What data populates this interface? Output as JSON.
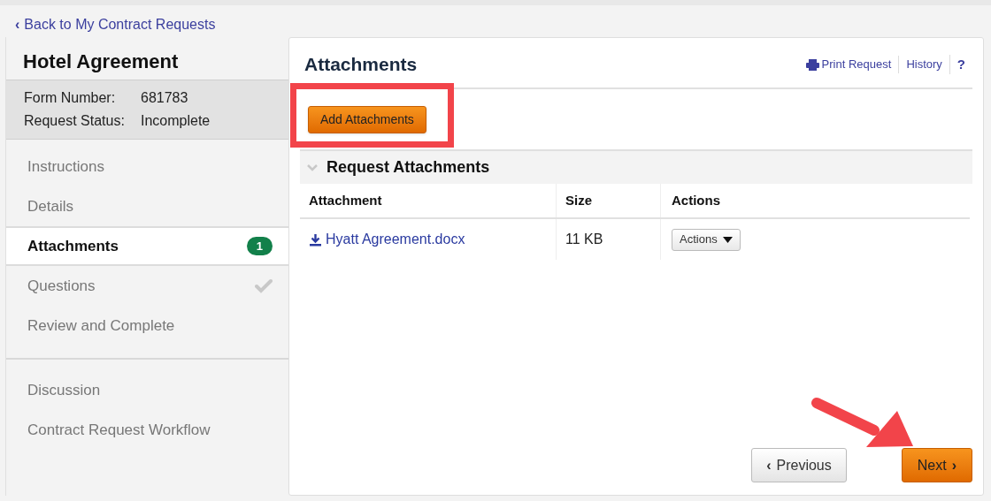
{
  "back_link": {
    "icon": "‹",
    "label": "Back to My Contract Requests"
  },
  "form": {
    "title": "Hotel Agreement",
    "fields": [
      {
        "label": "Form Number:",
        "value": "681783"
      },
      {
        "label": "Request Status:",
        "value": "Incomplete"
      }
    ]
  },
  "nav_groups": [
    [
      {
        "label": "Instructions",
        "selected": false,
        "completed": false
      },
      {
        "label": "Details",
        "selected": false,
        "completed": false
      },
      {
        "label": "Attachments",
        "selected": true,
        "completed": false,
        "badge": "1"
      },
      {
        "label": "Questions",
        "selected": false,
        "completed": true
      },
      {
        "label": "Review and Complete",
        "selected": false,
        "completed": false
      }
    ],
    [
      {
        "label": "Discussion",
        "selected": false,
        "completed": false
      },
      {
        "label": "Contract Request Workflow",
        "selected": false,
        "completed": false
      }
    ]
  ],
  "panel": {
    "title": "Attachments",
    "links": [
      {
        "kind": "print",
        "label": "Print Request"
      },
      {
        "kind": "text",
        "label": "History"
      },
      {
        "kind": "text",
        "label": "?"
      }
    ],
    "add_button": "Add Attachments",
    "highlighted": true,
    "section": {
      "title": "Request Attachments",
      "expanded": true,
      "columns": [
        "Attachment",
        "Size",
        "Actions"
      ],
      "rows": [
        {
          "file": "Hyatt Agreement.docx",
          "size": "11 KB",
          "action": "Actions"
        }
      ]
    },
    "previous": {
      "icon": "‹",
      "label": "Previous"
    },
    "next": {
      "label": "Next",
      "icon": "›"
    },
    "arrow_pointer": true
  }
}
